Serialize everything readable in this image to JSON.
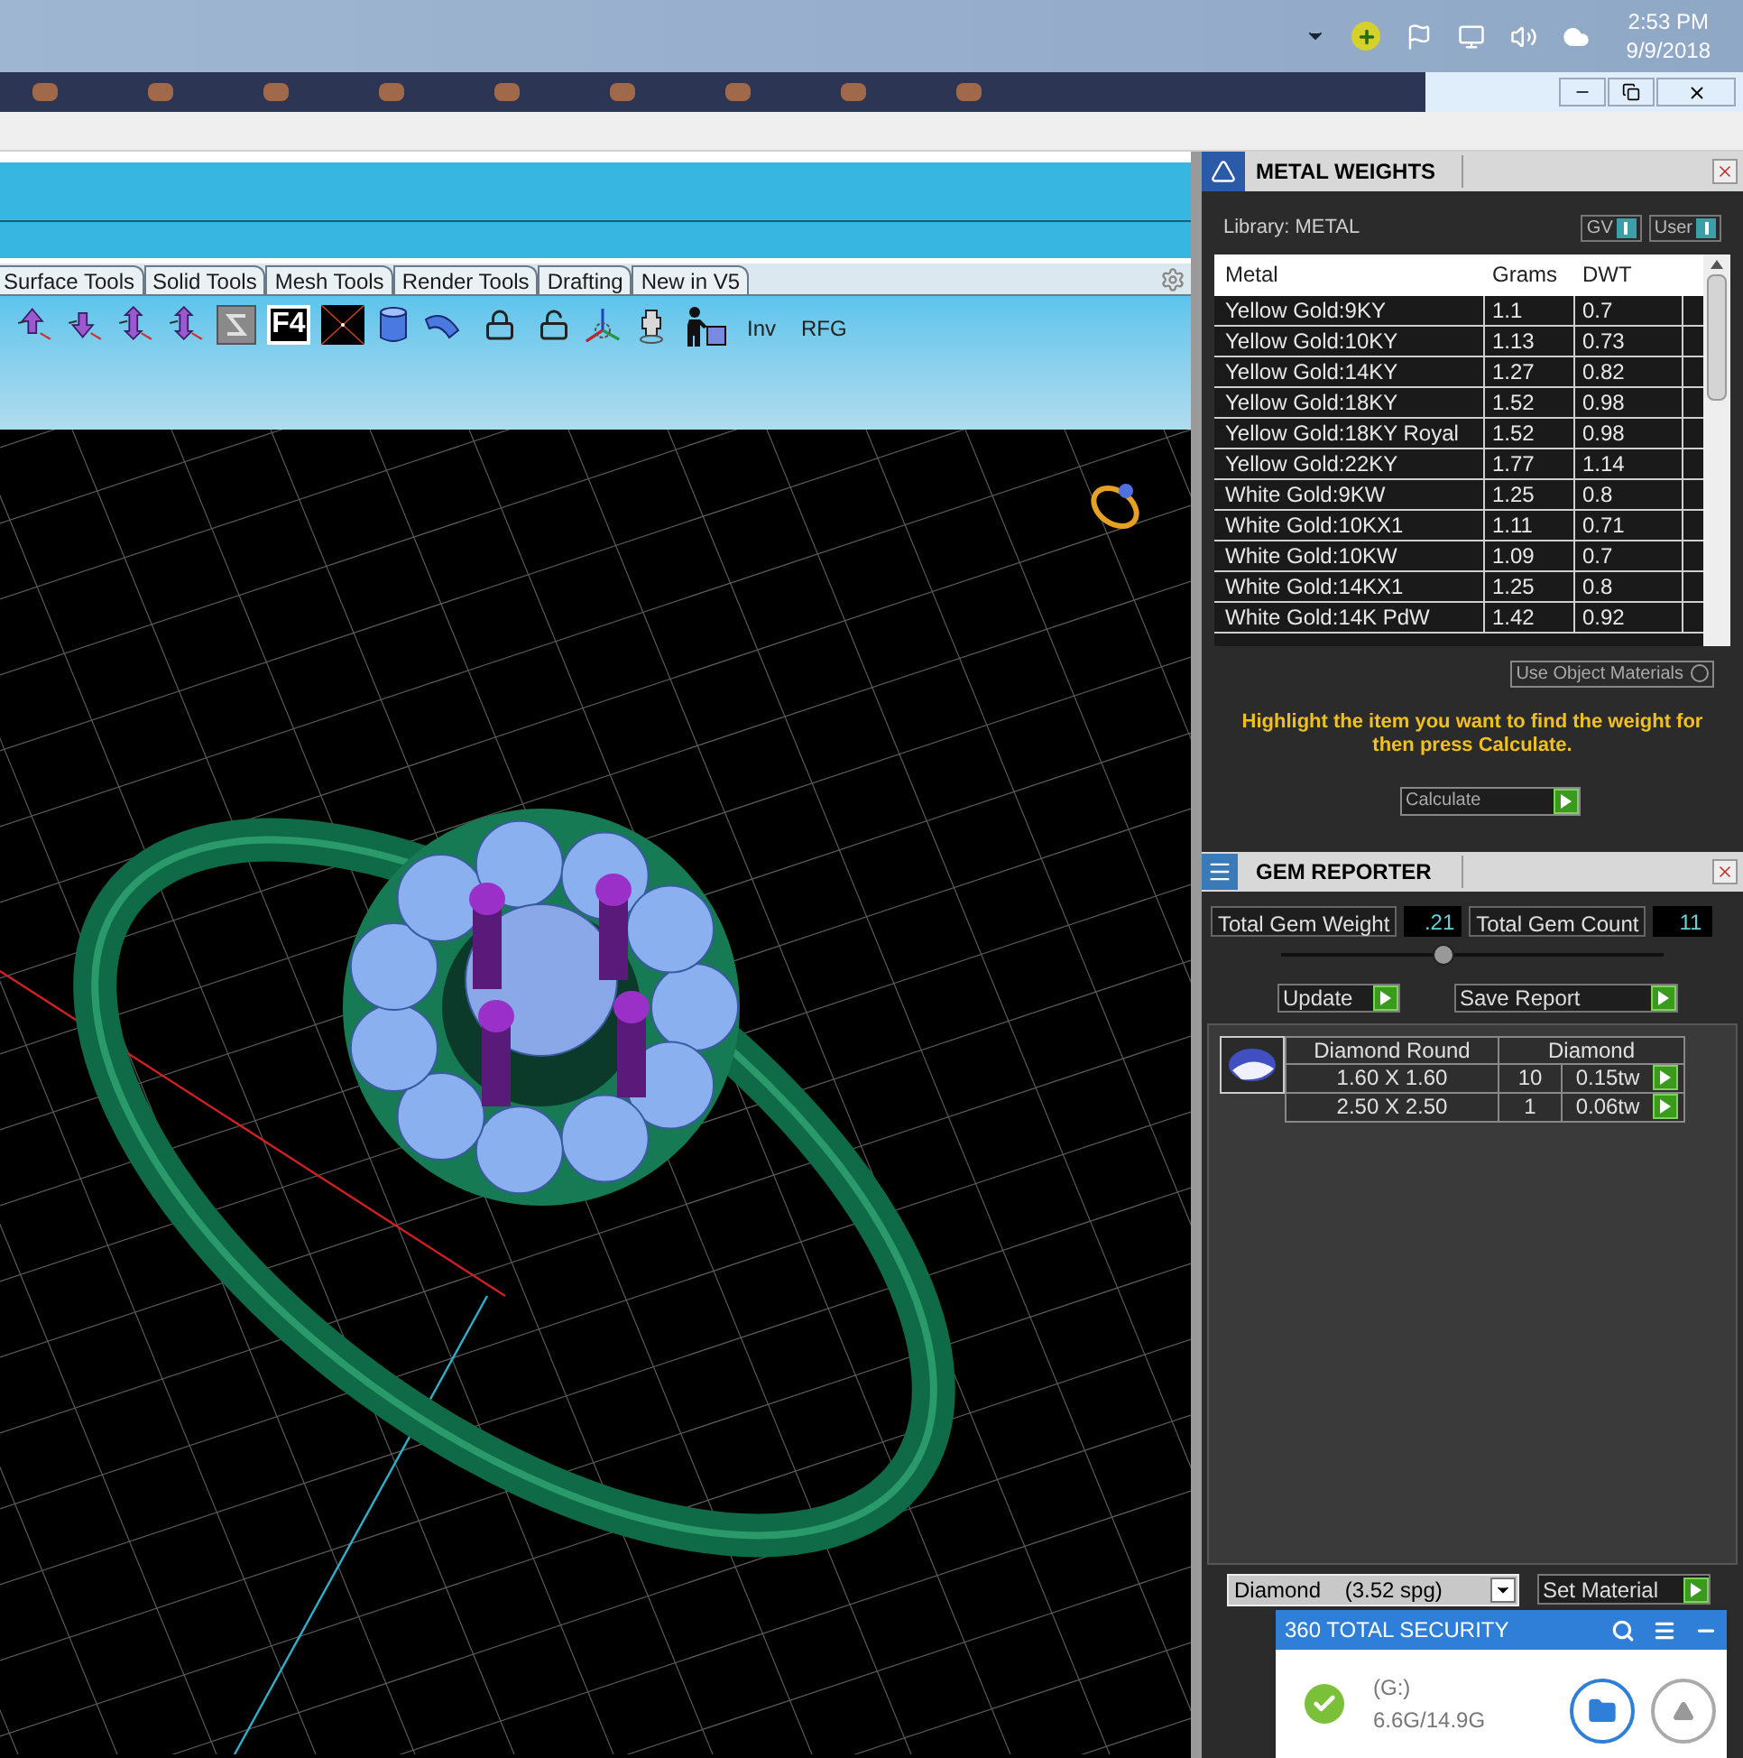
{
  "tray": {
    "time": "2:53 PM",
    "date": "9/9/2018"
  },
  "tabs": [
    {
      "label": "Surface Tools",
      "selected": false
    },
    {
      "label": "Solid Tools",
      "selected": false
    },
    {
      "label": "Mesh Tools",
      "selected": false
    },
    {
      "label": "Render Tools",
      "selected": false
    },
    {
      "label": "Drafting",
      "selected": false
    },
    {
      "label": "New in V5",
      "selected": false
    }
  ],
  "toolbar": {
    "key_label": "F4",
    "text_buttons": [
      "Inv",
      "RFG"
    ]
  },
  "metal_weights": {
    "title": "METAL WEIGHTS",
    "library_label": "Library: METAL",
    "toggles": [
      {
        "label": "GV",
        "on": true
      },
      {
        "label": "User",
        "on": true
      }
    ],
    "columns": [
      "Metal",
      "Grams",
      "DWT"
    ],
    "rows": [
      {
        "metal": "Yellow Gold:9KY",
        "grams": "1.1",
        "dwt": "0.7"
      },
      {
        "metal": "Yellow Gold:10KY",
        "grams": "1.13",
        "dwt": "0.73"
      },
      {
        "metal": "Yellow Gold:14KY",
        "grams": "1.27",
        "dwt": "0.82"
      },
      {
        "metal": "Yellow Gold:18KY",
        "grams": "1.52",
        "dwt": "0.98"
      },
      {
        "metal": "Yellow Gold:18KY Royal",
        "grams": "1.52",
        "dwt": "0.98"
      },
      {
        "metal": "Yellow Gold:22KY",
        "grams": "1.77",
        "dwt": "1.14"
      },
      {
        "metal": "White Gold:9KW",
        "grams": "1.25",
        "dwt": "0.8"
      },
      {
        "metal": "White Gold:10KX1",
        "grams": "1.11",
        "dwt": "0.71"
      },
      {
        "metal": "White Gold:10KW",
        "grams": "1.09",
        "dwt": "0.7"
      },
      {
        "metal": "White Gold:14KX1",
        "grams": "1.25",
        "dwt": "0.8"
      },
      {
        "metal": "White Gold:14K PdW",
        "grams": "1.42",
        "dwt": "0.92"
      }
    ],
    "use_object_materials": {
      "label": "Use Object Materials",
      "checked": false
    },
    "hint": "Highlight the item you want to find the weight for then press Calculate.",
    "calculate_button": "Calculate"
  },
  "gem_reporter": {
    "title": "GEM REPORTER",
    "total_weight": {
      "label": "Total Gem Weight",
      "value": ".21"
    },
    "total_count": {
      "label": "Total Gem Count",
      "value": "11"
    },
    "slider": {
      "level": 0.43
    },
    "buttons": [
      "Update",
      "Save Report"
    ],
    "gem_table": {
      "shape": "Diamond Round",
      "material": "Diamond",
      "rows": [
        {
          "size": "1.60 X 1.60",
          "count": "10",
          "weight": "0.15tw"
        },
        {
          "size": "2.50 X 2.50",
          "count": "1",
          "weight": "0.06tw"
        }
      ]
    },
    "material_select": {
      "value": "Diamond    (3.52 spg)"
    },
    "set_material_button": "Set Material"
  },
  "security_popup": {
    "title": "360 TOTAL SECURITY",
    "drive": "(G:)",
    "usage": "6.6G/14.9G"
  }
}
